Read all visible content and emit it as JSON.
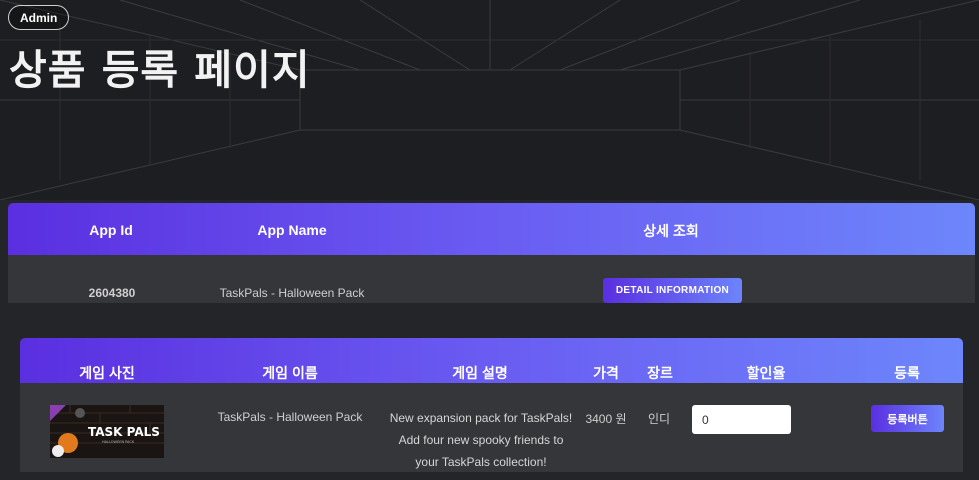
{
  "header": {
    "badge": "Admin",
    "title": "상품 등록 페이지"
  },
  "app_table": {
    "columns": [
      "App Id",
      "App Name",
      "상세 조회"
    ],
    "row": {
      "app_id": "2604380",
      "app_name": "TaskPals - Halloween Pack",
      "detail_button": "DETAIL INFORMATION"
    }
  },
  "product_table": {
    "columns": [
      "게임 사진",
      "게임 이름",
      "게임 설명",
      "가격",
      "장르",
      "할인율",
      "등록"
    ],
    "row": {
      "image_text": "TASK PALS",
      "image_subtext": "HALLOWEEN PACK",
      "name": "TaskPals - Halloween Pack",
      "description": "New expansion pack for TaskPals! Add four new spooky friends to your TaskPals collection!",
      "price": "3400 원",
      "genre": "인디",
      "discount_value": "0",
      "register_button": "등록버튼"
    }
  },
  "colors": {
    "accent_start": "#5a2fe0",
    "accent_end": "#6d86fb",
    "background": "#242528",
    "row_background": "#35363a"
  }
}
